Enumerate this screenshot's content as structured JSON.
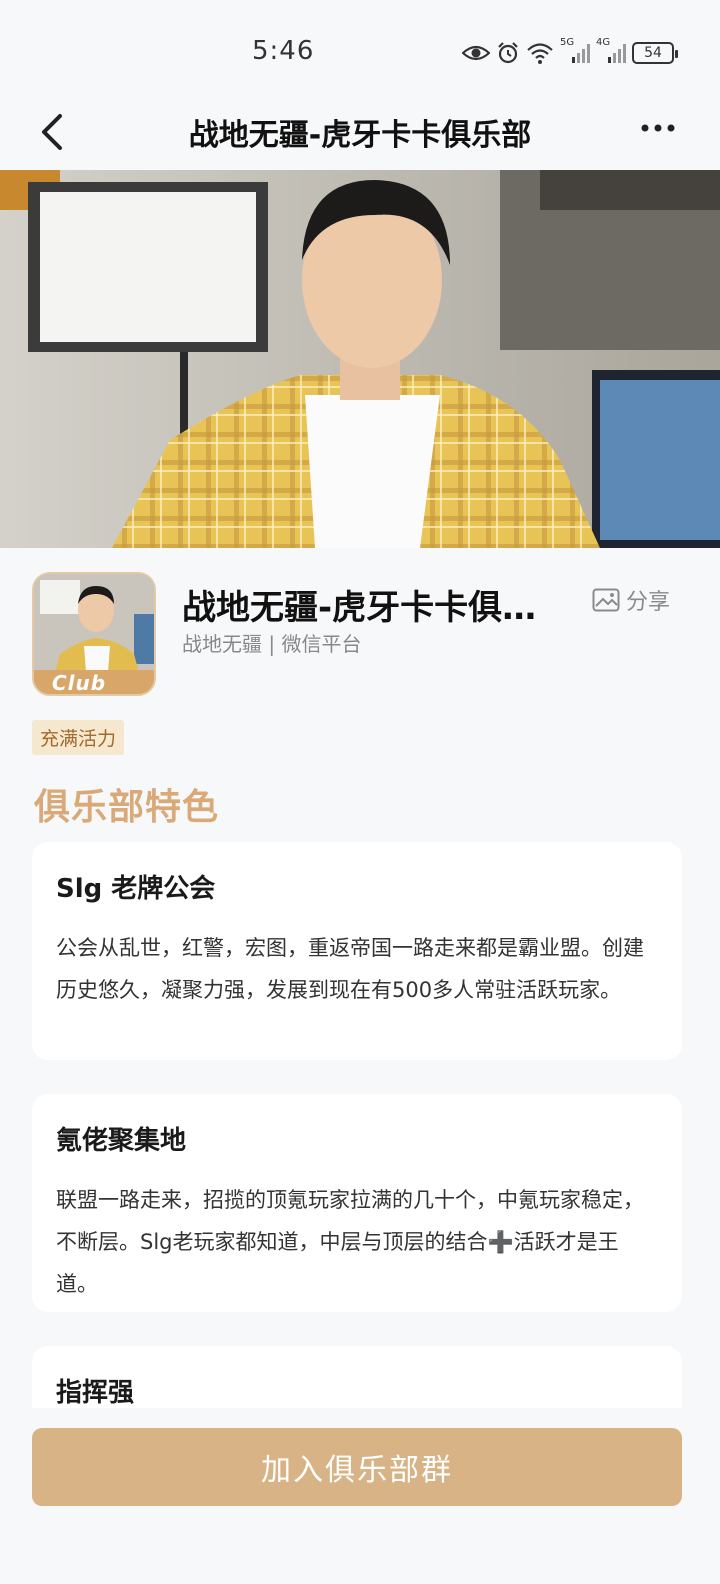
{
  "status_bar": {
    "time": "5:46",
    "net1": "5G",
    "net2": "4G",
    "battery": "54",
    "icons": [
      "eye-icon",
      "alarm-icon",
      "wifi-icon",
      "signal-5g-icon",
      "signal-4g-icon",
      "battery-icon"
    ]
  },
  "nav": {
    "title": "战地无疆-虎牙卡卡俱乐部",
    "back_icon": "chevron-left-icon",
    "more_icon": "more-horizontal-icon"
  },
  "profile": {
    "name": "战地无疆-虎牙卡卡俱…",
    "subtitle": "战地无疆 | 微信平台",
    "share_label": "分享",
    "avatar_badge": "Club",
    "tag": "充满活力"
  },
  "section_title": "俱乐部特色",
  "features": [
    {
      "title": "Slg 老牌公会",
      "body": "公会从乱世，红警，宏图，重返帝国一路走来都是霸业盟。创建历史悠久，凝聚力强，发展到现在有500多人常驻活跃玩家。"
    },
    {
      "title": "氪佬聚集地",
      "body": "联盟一路走来，招揽的顶氪玩家拉满的几十个，中氪玩家稳定，不断层。Slg老玩家都知道，中层与顶层的结合➕活跃才是王道。"
    },
    {
      "title": "指挥强",
      "body": ""
    }
  ],
  "bottom": {
    "join_label": "加入俱乐部群"
  },
  "colors": {
    "accent": "#d7b386",
    "section_title": "#d9aa78",
    "tag_bg": "#f6e7cf",
    "tag_text": "#a06a2c",
    "background": "#f7f8fa"
  }
}
